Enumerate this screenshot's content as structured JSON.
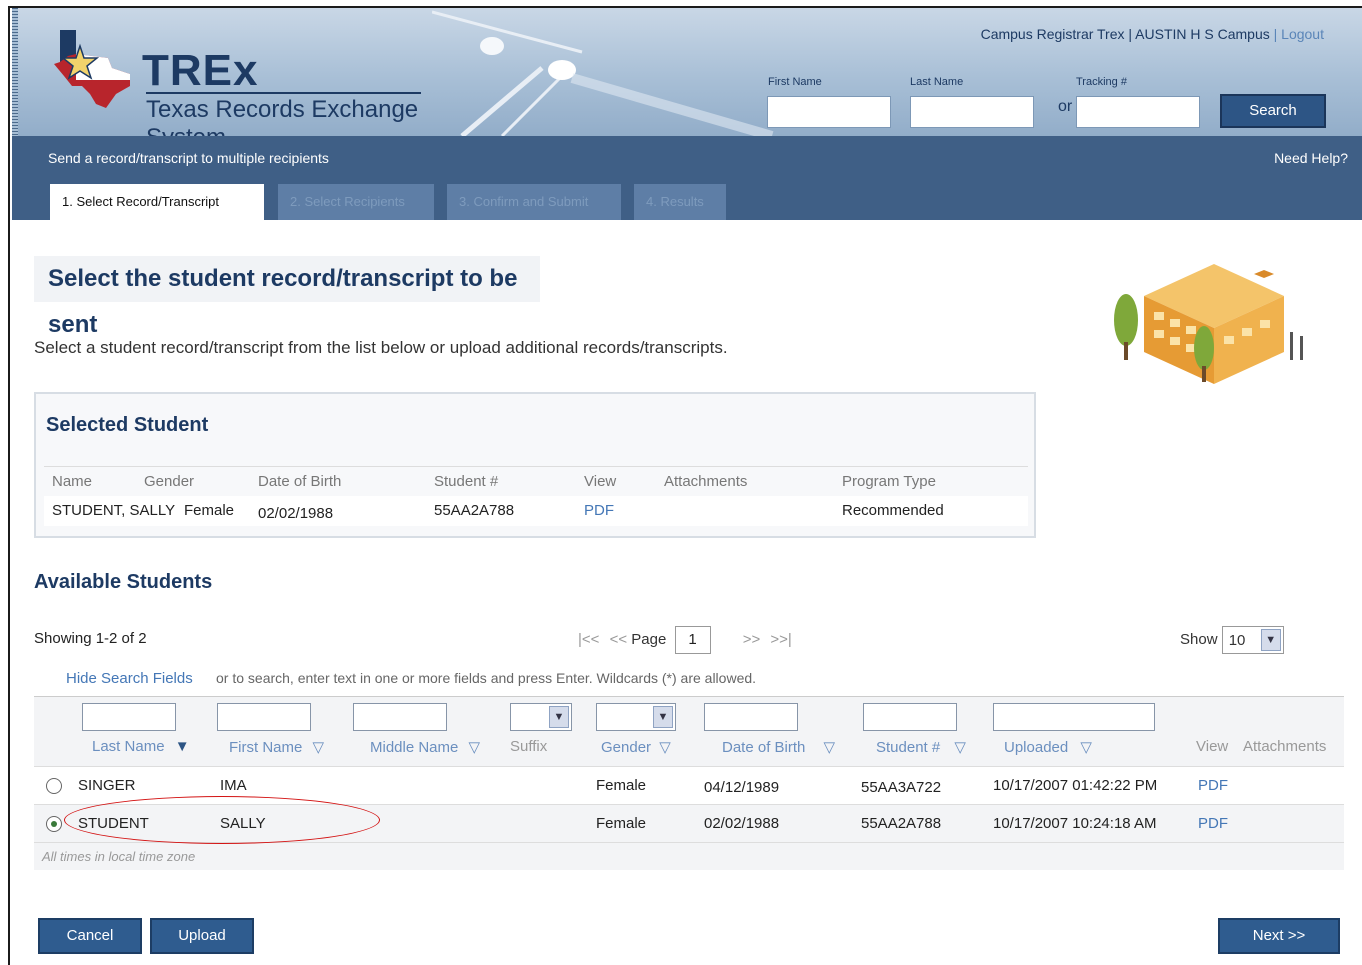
{
  "header": {
    "logo_title": "TREx",
    "logo_subtitle": "Texas Records Exchange System",
    "user_info": "Campus Registrar Trex | AUSTIN H S Campus",
    "logout": "| Logout",
    "first_name_label": "First Name",
    "last_name_label": "Last Name",
    "tracking_label": "Tracking #",
    "or_label": "or",
    "search_button": "Search"
  },
  "nav": {
    "title": "Send a record/transcript to multiple recipients",
    "help": "Need Help?",
    "tabs": [
      {
        "label": "1. Select Record/Transcript",
        "state": "active"
      },
      {
        "label": "2. Select Recipients",
        "state": "disabled"
      },
      {
        "label": "3. Confirm and Submit",
        "state": "disabled"
      },
      {
        "label": "4. Results",
        "state": "disabled"
      }
    ]
  },
  "main": {
    "page_title": "Select the student record/transcript to be sent",
    "intro": "Select a student record/transcript from the list below or upload additional records/transcripts."
  },
  "selected_student": {
    "title": "Selected Student",
    "columns": [
      "Name",
      "Gender",
      "Date of Birth",
      "Student #",
      "View",
      "Attachments",
      "Program Type"
    ],
    "row": {
      "name": "STUDENT, SALLY",
      "gender": "Female",
      "dob": "02/02/1988",
      "student_no": "55AA2A788",
      "view": "PDF",
      "attachments": "",
      "program_type": "Recommended"
    }
  },
  "available": {
    "title": "Available Students",
    "showing": "Showing 1-2 of 2",
    "pager": {
      "first": "|<<",
      "prev": "<<",
      "page_label": "Page",
      "page_value": "1",
      "next": ">>",
      "last": ">>|"
    },
    "show_label": "Show",
    "show_value": "10",
    "hide_search": "Hide Search Fields",
    "search_hint": "or to search, enter text in one or more fields and press Enter. Wildcards (*) are allowed.",
    "columns": {
      "last_name": "Last Name",
      "first_name": "First Name",
      "middle_name": "Middle Name",
      "suffix": "Suffix",
      "gender": "Gender",
      "dob": "Date of Birth",
      "student_no": "Student #",
      "uploaded": "Uploaded",
      "view": "View",
      "attachments": "Attachments"
    },
    "sort_desc_glyph": "▼",
    "sort_glyph": "▽",
    "rows": [
      {
        "selected": false,
        "last": "SINGER",
        "first": "IMA",
        "middle": "",
        "suffix": "",
        "gender": "Female",
        "dob": "04/12/1989",
        "student_no": "55AA3A722",
        "uploaded": "10/17/2007 01:42:22 PM",
        "view": "PDF"
      },
      {
        "selected": true,
        "last": "STUDENT",
        "first": "SALLY",
        "middle": "",
        "suffix": "",
        "gender": "Female",
        "dob": "02/02/1988",
        "student_no": "55AA2A788",
        "uploaded": "10/17/2007 10:24:18 AM",
        "view": "PDF"
      }
    ],
    "footnote": "All times in local time zone"
  },
  "buttons": {
    "cancel": "Cancel",
    "upload": "Upload",
    "next": "Next >>"
  },
  "colors": {
    "header_bg": "#a8bfd6",
    "nav_bg": "#3f5f86",
    "brand_dark": "#1d3a63",
    "link": "#4477b6",
    "button": "#2f5c8f",
    "highlight": "#d31313"
  }
}
